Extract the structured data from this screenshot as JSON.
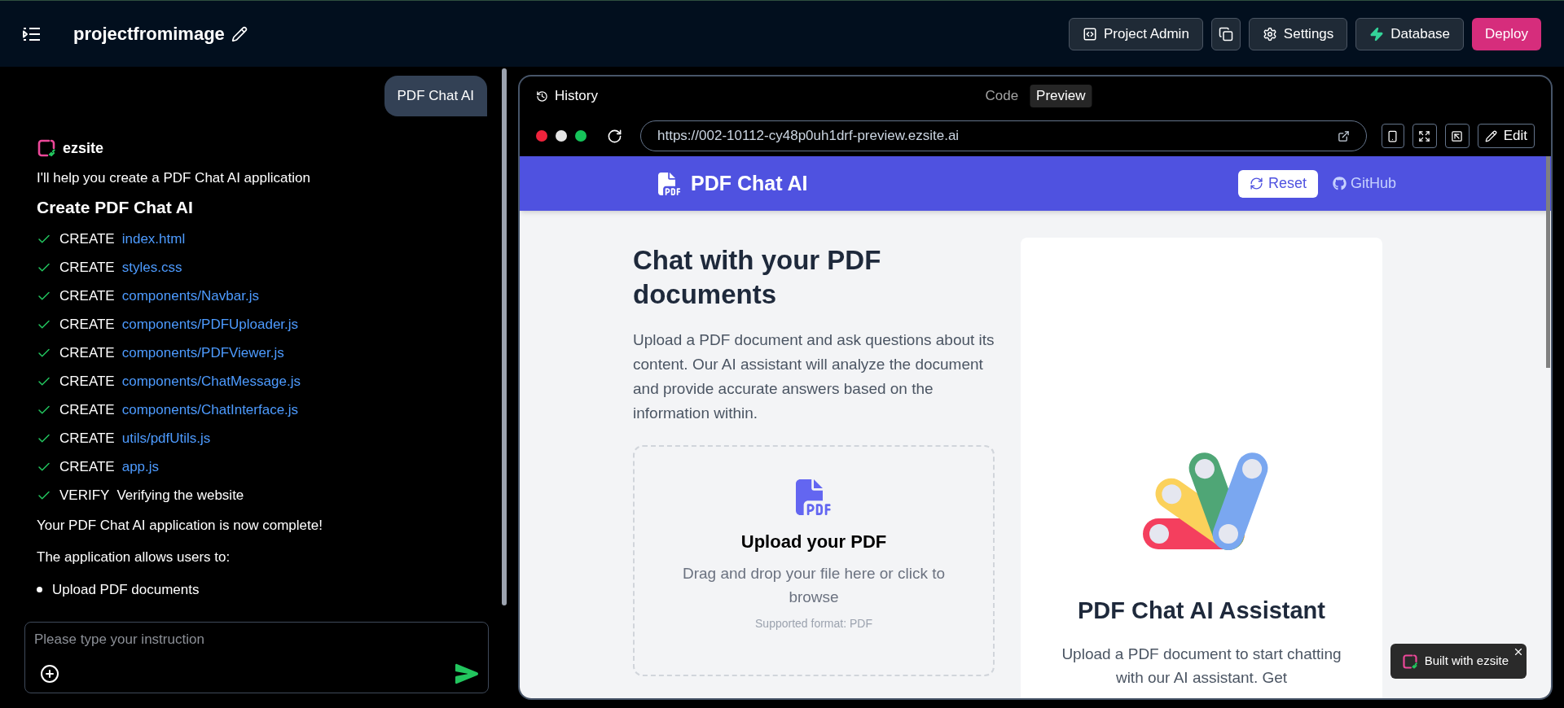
{
  "top_bar": {
    "title": "projectfromimage",
    "buttons": [
      {
        "kind": "outline",
        "label": "Project Admin"
      },
      {
        "kind": "icon_only"
      },
      {
        "kind": "outline",
        "label": "Settings"
      },
      {
        "kind": "outline",
        "label": "Database"
      },
      {
        "kind": "primary",
        "label": "Deploy"
      }
    ]
  },
  "chat": {
    "user_message": "PDF Chat AI",
    "assistant_name": "ezsite",
    "intro": "I'll help you create a PDF Chat AI application",
    "heading": "Create PDF Chat AI",
    "steps": [
      {
        "kind": "file",
        "done": true,
        "action": "CREATE",
        "target": "index.html"
      },
      {
        "kind": "file",
        "done": true,
        "action": "CREATE",
        "target": "styles.css"
      },
      {
        "kind": "file",
        "done": true,
        "action": "CREATE",
        "target": "components/Navbar.js"
      },
      {
        "kind": "file",
        "done": true,
        "action": "CREATE",
        "target": "components/PDFUploader.js"
      },
      {
        "kind": "file",
        "done": true,
        "action": "CREATE",
        "target": "components/PDFViewer.js"
      },
      {
        "kind": "file",
        "done": true,
        "action": "CREATE",
        "target": "components/ChatMessage.js"
      },
      {
        "kind": "file",
        "done": true,
        "action": "CREATE",
        "target": "components/ChatInterface.js"
      },
      {
        "kind": "file",
        "done": true,
        "action": "CREATE",
        "target": "utils/pdfUtils.js"
      },
      {
        "kind": "file",
        "done": true,
        "action": "CREATE",
        "target": "app.js"
      },
      {
        "kind": "text",
        "done": true,
        "action": "VERIFY",
        "target": "Verifying the website"
      }
    ],
    "conclusion": "Your PDF Chat AI application is now complete!",
    "list_intro": "The application allows users to:",
    "bullets": [
      "Upload PDF documents"
    ],
    "input": {
      "placeholder": "Please type your instruction"
    }
  },
  "preview": {
    "history_label": "History",
    "view_tabs": [
      {
        "label": "Code",
        "selected": false
      },
      {
        "label": "Preview",
        "selected": true
      }
    ],
    "url": "https://002-10112-cy48p0uh1drf-preview.ezsite.ai",
    "edit_label": "Edit",
    "site": {
      "brand": "PDF Chat AI",
      "nav": [
        {
          "kind": "button",
          "label": "Reset"
        },
        {
          "kind": "link",
          "label": "GitHub"
        }
      ],
      "heading": "Chat with your PDF documents",
      "description": "Upload a PDF document and ask questions about its content. Our AI assistant will analyze the document and provide accurate answers based on the information within.",
      "upload": {
        "title": "Upload your PDF",
        "hint": "Drag and drop your file here or click to browse",
        "format": "Supported format: PDF"
      },
      "assistant_card": {
        "title": "PDF Chat AI Assistant",
        "text": "Upload a PDF document to start chatting with our AI assistant. Get"
      }
    },
    "badge": "Built with ezsite"
  }
}
